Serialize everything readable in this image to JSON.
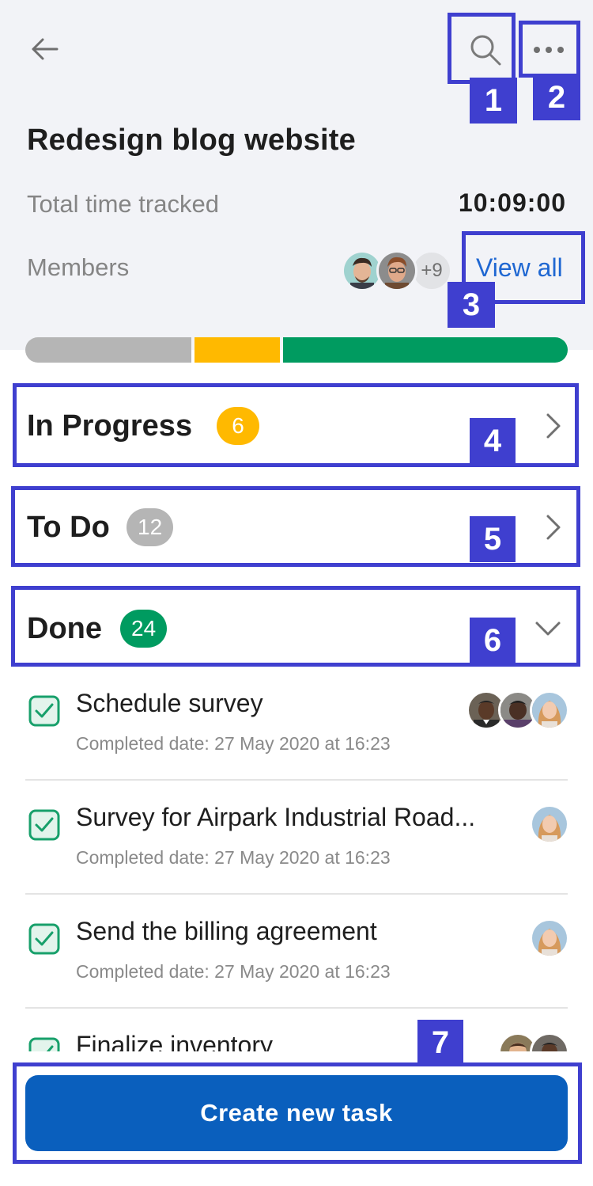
{
  "header": {
    "title": "Redesign blog website",
    "time_label": "Total time tracked",
    "time_value": "10:09:00",
    "members_label": "Members",
    "members_more": "+9",
    "view_all": "View all"
  },
  "sections": [
    {
      "title": "In Progress",
      "count": "6",
      "color": "#ffb900",
      "state": "collapsed"
    },
    {
      "title": "To Do",
      "count": "12",
      "color": "#b5b5b5",
      "state": "collapsed"
    },
    {
      "title": "Done",
      "count": "24",
      "color": "#009b60",
      "state": "expanded"
    }
  ],
  "tasks": [
    {
      "title": "Schedule survey",
      "date": "Completed date: 27 May 2020 at 16:23"
    },
    {
      "title": "Survey for Airpark Industrial Road...",
      "date": "Completed date: 27 May 2020 at 16:23"
    },
    {
      "title": "Send the billing agreement",
      "date": "Completed date: 27 May 2020 at 16:23"
    },
    {
      "title": "Finalize inventory",
      "date": ""
    }
  ],
  "create_button": "Create new task",
  "markers": [
    "1",
    "2",
    "3",
    "4",
    "5",
    "6",
    "7"
  ],
  "colors": {
    "accent": "#1f67d2",
    "button": "#0a5fbd",
    "annotation": "#3f3fcf",
    "header_bg": "#f2f3f7"
  },
  "icons": [
    "back-arrow-icon",
    "search-icon",
    "more-icon",
    "chevron-right-icon",
    "chevron-down-icon",
    "checkbox-checked-icon"
  ]
}
